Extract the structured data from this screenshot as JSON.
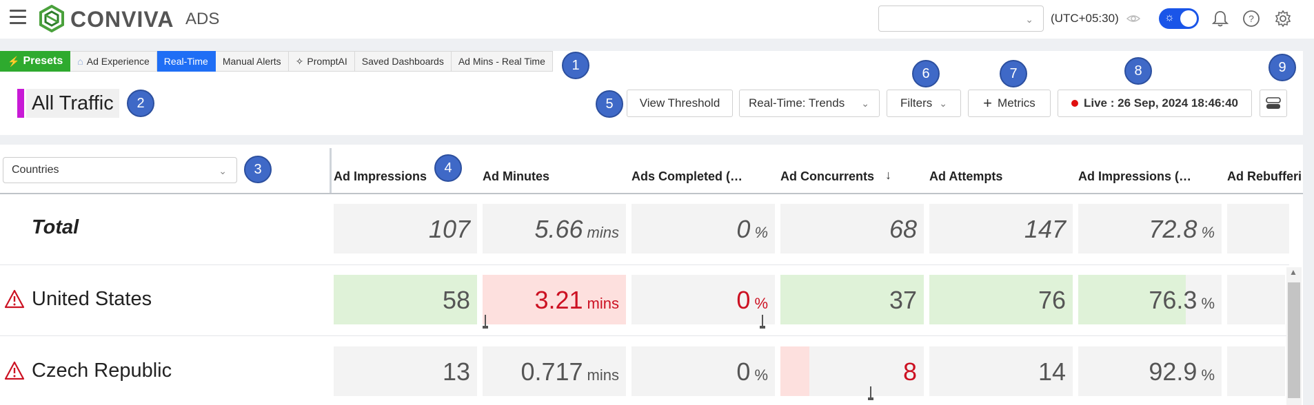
{
  "app": {
    "brand": "CONVIVA",
    "product": "ADS",
    "timezone": "(UTC+05:30)"
  },
  "tabs": [
    {
      "label": "Presets",
      "icon": "lightning-icon"
    },
    {
      "label": "Ad Experience",
      "icon": "home-icon"
    },
    {
      "label": "Real-Time",
      "active": true
    },
    {
      "label": "Manual Alerts"
    },
    {
      "label": "PromptAI",
      "icon": "sparkle-icon"
    },
    {
      "label": "Saved Dashboards"
    },
    {
      "label": "Ad Mins - Real Time"
    }
  ],
  "badges": [
    "1",
    "2",
    "3",
    "4",
    "5",
    "6",
    "7",
    "8",
    "9"
  ],
  "dashboard": {
    "title": "All Traffic",
    "title_color": "#c81ad6"
  },
  "toolbar": {
    "view_threshold": "View Threshold",
    "view_select": "Real-Time: Trends",
    "filters": "Filters",
    "metrics": "Metrics",
    "live": "Live : 26 Sep, 2024 18:46:40"
  },
  "table": {
    "dimension": "Countries",
    "columns": [
      "Ad Impressions",
      "Ad Minutes",
      "Ads Completed (…",
      "Ad Concurrents",
      "Ad Attempts",
      "Ad Impressions (…",
      "Ad Rebufferi"
    ],
    "sorted_column": "Ad Concurrents",
    "rows": [
      {
        "label": "Total",
        "alert": false,
        "cells": [
          {
            "value": "107",
            "unit": ""
          },
          {
            "value": "5.66",
            "unit": "mins"
          },
          {
            "value": "0",
            "unit": "%"
          },
          {
            "value": "68",
            "unit": ""
          },
          {
            "value": "147",
            "unit": ""
          },
          {
            "value": "72.8",
            "unit": "%"
          },
          {
            "value": "",
            "unit": ""
          }
        ]
      },
      {
        "label": "United States",
        "alert": true,
        "cells": [
          {
            "value": "58",
            "unit": "",
            "status": "good",
            "fill": 1.0
          },
          {
            "value": "3.21",
            "unit": "mins",
            "status": "bad",
            "fill": 1.0
          },
          {
            "value": "0",
            "unit": "%",
            "status": "bad",
            "fill": 0
          },
          {
            "value": "37",
            "unit": "",
            "status": "good",
            "fill": 1.0
          },
          {
            "value": "76",
            "unit": "",
            "status": "good",
            "fill": 1.0
          },
          {
            "value": "76.3",
            "unit": "%",
            "status": "good",
            "fill": 0.75
          },
          {
            "value": "",
            "unit": ""
          }
        ]
      },
      {
        "label": "Czech Republic",
        "alert": true,
        "cells": [
          {
            "value": "13",
            "unit": ""
          },
          {
            "value": "0.717",
            "unit": "mins"
          },
          {
            "value": "0",
            "unit": "%"
          },
          {
            "value": "8",
            "unit": "",
            "status": "bad",
            "fill": 0.2
          },
          {
            "value": "14",
            "unit": ""
          },
          {
            "value": "92.9",
            "unit": "%"
          },
          {
            "value": "",
            "unit": ""
          }
        ]
      }
    ]
  },
  "colors": {
    "good": "#dff2d8",
    "bad": "#fde0de",
    "bad_text": "#cc1122",
    "accent": "#1f6ef5",
    "presets": "#2eaa2e"
  }
}
